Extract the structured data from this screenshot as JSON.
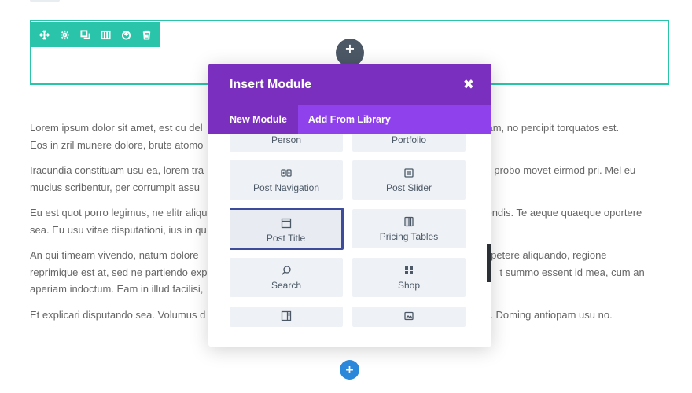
{
  "section": {
    "toolbar_icons": [
      "move-icon",
      "settings-icon",
      "duplicate-icon",
      "columns-icon",
      "save-icon",
      "delete-icon"
    ],
    "add_row_symbol": "+"
  },
  "content": {
    "paragraphs": [
      "Lorem ipsum dolor sit amet, est cu del",
      "Eos in zril munere dolore, brute atomo",
      "constituam, no percipit torquatos est.",
      "Iracundia constituam usu ea, lorem tra",
      "mucius scribentur, per corrumpit assu",
      "t probo movet eirmod pri. Mel eu",
      "Eu est quot porro legimus, ne elitr aliqu",
      "sea. Eu usu vitae disputationi, ius in qu",
      "endis. Te aeque quaeque oportere",
      "An qui timeam vivendo, natum dolore",
      "reprimique est at, sed ne partiendo exp",
      "aperiam indoctum. Eam in illud facilisi,",
      "appetere aliquando, regione",
      "t summo essent id mea, cum an",
      "Et explicari disputando sea. Volumus d",
      ". Doming antiopam usu no."
    ]
  },
  "modal": {
    "title": "Insert Module",
    "close_symbol": "✖",
    "tabs": [
      {
        "label": "New Module",
        "active": true
      },
      {
        "label": "Add From Library",
        "active": false
      }
    ],
    "modules": [
      {
        "label": "Person",
        "icon": "person-icon"
      },
      {
        "label": "Portfolio",
        "icon": "portfolio-icon"
      },
      {
        "label": "Post Navigation",
        "icon": "post-navigation-icon"
      },
      {
        "label": "Post Slider",
        "icon": "post-slider-icon"
      },
      {
        "label": "Post Title",
        "icon": "post-title-icon",
        "selected": true
      },
      {
        "label": "Pricing Tables",
        "icon": "pricing-tables-icon"
      },
      {
        "label": "Search",
        "icon": "search-icon"
      },
      {
        "label": "Shop",
        "icon": "shop-icon"
      },
      {
        "label": "",
        "icon": "sidebar-icon"
      },
      {
        "label": "",
        "icon": "slider-icon"
      }
    ]
  },
  "add_section_symbol": "+",
  "colors": {
    "section_accent": "#29c4a9",
    "modal_header": "#7b2fbe",
    "modal_tabs": "#8f42ec",
    "selected_border": "#3c4b9a",
    "add_button": "#2b87da"
  }
}
